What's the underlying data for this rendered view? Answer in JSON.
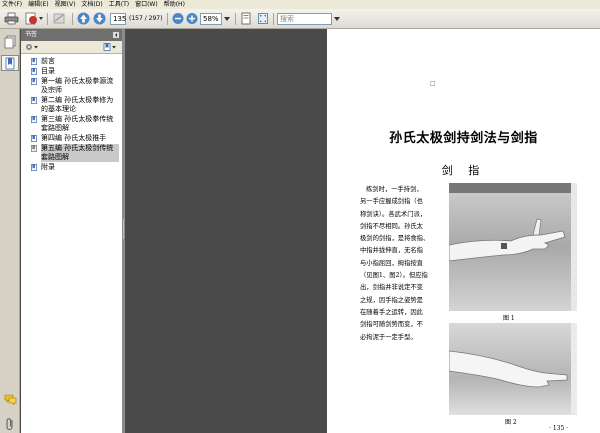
{
  "menu": {
    "items": [
      "文件(F)",
      "编辑(E)",
      "视图(V)",
      "文档(D)",
      "工具(T)",
      "窗口(W)",
      "帮助(H)"
    ]
  },
  "toolbar": {
    "page_number": "135",
    "page_count": "(157 / 297)",
    "zoom": "58%",
    "search_placeholder": "搜索"
  },
  "bookmarks": {
    "header": "书签",
    "items": [
      {
        "label": "前言",
        "selected": false
      },
      {
        "label": "目录",
        "selected": false
      },
      {
        "label": "第一编 孙氏太极拳源流及宗师",
        "selected": false
      },
      {
        "label": "第二编 孙氏太极拳修为的基本理论",
        "selected": false
      },
      {
        "label": "第三编 孙氏太极拳传统套路图解",
        "selected": false
      },
      {
        "label": "第四编 孙氏太极推手",
        "selected": false
      },
      {
        "label": "第五编 孙氏太极剑传统套路图解",
        "selected": true
      },
      {
        "label": "附录",
        "selected": false
      }
    ]
  },
  "document": {
    "title": "孙氏太极剑持剑法与剑指",
    "section": "剑 指",
    "paragraph_lines": [
      "练剑时，一手持剑，",
      "另一手应握成剑指（也",
      "称剑诀）。各武术门派，",
      "剑指不尽相同。孙氏太",
      "极剑的剑指，是将食指、",
      "中指并拢伸直，无名指",
      "与小指屈回，拇指按直",
      "（见图1、图2）。但应指",
      "出，剑指并非说定不变",
      "之规，因手指之姿势是",
      "在随着手之运转，因此",
      "剑指可随剑势而变，不",
      "必拘泥于一定手型。"
    ],
    "figure1_caption": "图 1",
    "figure2_caption": "图 2",
    "page_footer": "· 135 ·",
    "top_mark": "□"
  },
  "colors": {
    "dark_background": "#4a4a4a",
    "toolbar_light": "#f4f3ee",
    "panel_header": "#6f6f6f",
    "selected_bookmark": "#c9c9c9"
  }
}
